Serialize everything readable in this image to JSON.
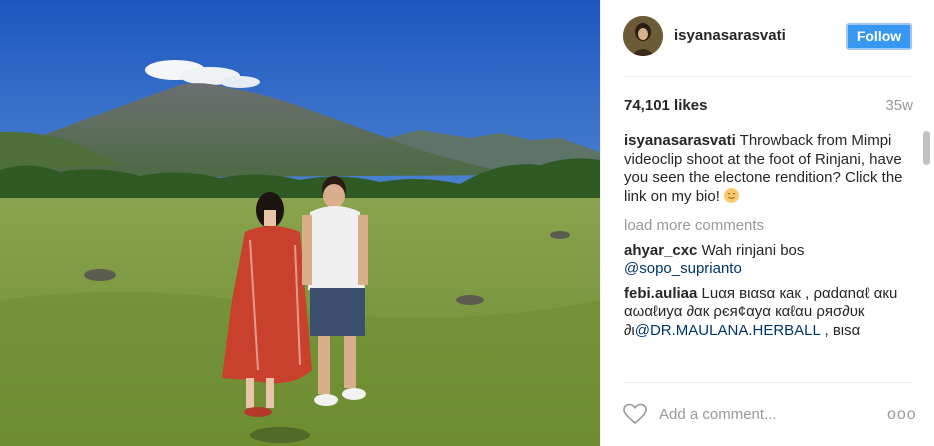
{
  "post": {
    "photo": {
      "colors": {
        "sky_top": "#1f5fc4",
        "sky_bottom": "#7fb3e8",
        "mountain": "#5a6a5a",
        "grass": "#7a9a3a",
        "shawl": "#c9402c"
      }
    },
    "author": {
      "username": "isyanasarasvati",
      "follow_label": "Follow"
    },
    "likes": "74,101 likes",
    "time_ago": "35w",
    "caption": {
      "username": "isyanasarasvati",
      "text": "Throwback from Mimpi videoclip shoot at the foot of Rinjani, have you seen the electone rendition? Click the link on my bio!",
      "emoji_icon": "smiling-face-icon"
    },
    "load_more": "load more comments",
    "comments": [
      {
        "username": "ahyar_cxc",
        "text": "Wah rinjani bos",
        "mention": "@sopo_suprianto"
      },
      {
        "username": "febi.auliaa",
        "text_before": "Luαя вιαѕα кaк , ραdαnαℓ αкu αωαℓиуα ∂αк ρєя¢αуα кαℓαu ρяσ∂υк ∂ι",
        "mention": "@DR.MAULANA.HERBALL",
        "text_after": ", вιѕα"
      }
    ],
    "add_comment_placeholder": "Add a comment...",
    "more_label": "ooo"
  }
}
